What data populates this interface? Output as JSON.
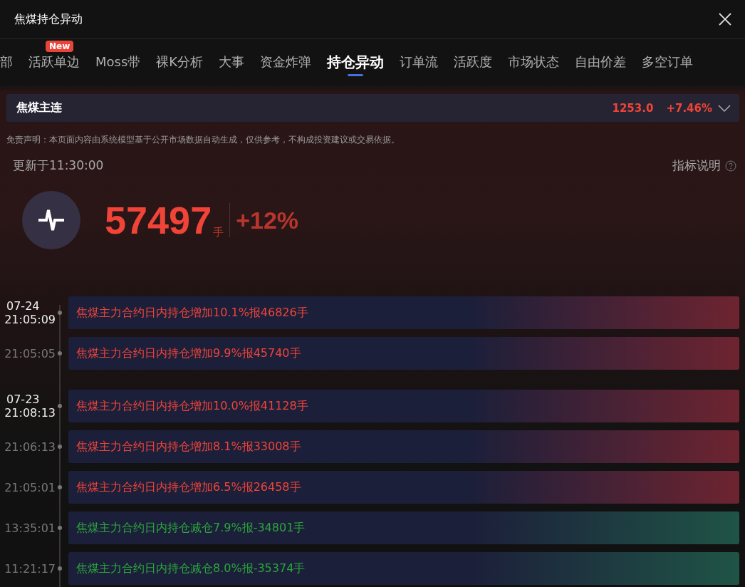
{
  "window": {
    "title": "焦煤持仓异动"
  },
  "tabs": [
    {
      "label": "部",
      "selected": false
    },
    {
      "label": "活跃单边",
      "selected": false,
      "badge": "New"
    },
    {
      "label": "Moss带",
      "selected": false
    },
    {
      "label": "裸K分析",
      "selected": false
    },
    {
      "label": "大事",
      "selected": false
    },
    {
      "label": "资金炸弹",
      "selected": false
    },
    {
      "label": "持仓异动",
      "selected": true
    },
    {
      "label": "订单流",
      "selected": false
    },
    {
      "label": "活跃度",
      "selected": false
    },
    {
      "label": "市场状态",
      "selected": false
    },
    {
      "label": "自由价差",
      "selected": false
    },
    {
      "label": "多空订单",
      "selected": false
    }
  ],
  "instrument": {
    "name": "焦煤主连",
    "price": "1253.0",
    "change": "+7.46%"
  },
  "disclaimer": "免责声明：本页面内容由系统模型基于公开市场数据自动生成，仅供参考，不构成投资建议或交易依据。",
  "update": {
    "text": "更新于11:30:00",
    "help": "指标说明"
  },
  "summary": {
    "value": "57497",
    "unit": "手",
    "change": "+12%"
  },
  "days": [
    {
      "date": "07-24",
      "events": [
        {
          "time": "21:05:09",
          "text": "焦煤主力合约日内持仓增加10.1%报46826手",
          "kind": "up"
        },
        {
          "time": "21:05:05",
          "text": "焦煤主力合约日内持仓增加9.9%报45740手",
          "kind": "up"
        }
      ]
    },
    {
      "date": "07-23",
      "events": [
        {
          "time": "21:08:13",
          "text": "焦煤主力合约日内持仓增加10.0%报41128手",
          "kind": "up"
        },
        {
          "time": "21:06:13",
          "text": "焦煤主力合约日内持仓增加8.1%报33008手",
          "kind": "up"
        },
        {
          "time": "21:05:01",
          "text": "焦煤主力合约日内持仓增加6.5%报26458手",
          "kind": "up"
        },
        {
          "time": "13:35:01",
          "text": "焦煤主力合约日内持仓减仓7.9%报-34801手",
          "kind": "down"
        },
        {
          "time": "11:21:17",
          "text": "焦煤主力合约日内持仓减仓8.0%报-35374手",
          "kind": "down"
        }
      ]
    }
  ]
}
